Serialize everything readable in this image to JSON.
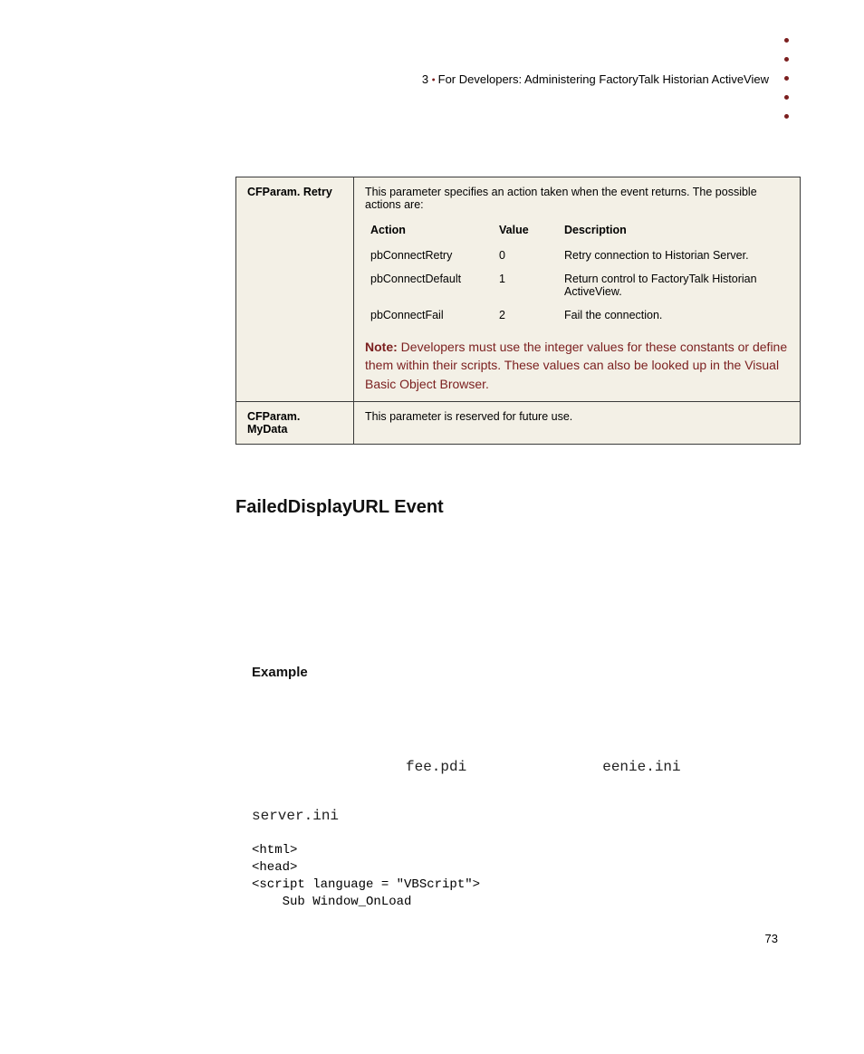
{
  "header": {
    "chapter_num": "3",
    "chapter_title": "For Developers: Administering FactoryTalk Historian ActiveView"
  },
  "table": {
    "rows": [
      {
        "param": "CFParam. Retry",
        "desc_intro": "This parameter specifies an action taken when the event returns. The possible actions are:",
        "subtable": {
          "headers": [
            "Action",
            "Value",
            "Description"
          ],
          "rows": [
            [
              "pbConnectRetry",
              "0",
              "Retry connection to Historian Server."
            ],
            [
              "pbConnectDefault",
              "1",
              "Return control to FactoryTalk Historian ActiveView."
            ],
            [
              "pbConnectFail",
              "2",
              "Fail the connection."
            ]
          ]
        },
        "note_label": "Note:",
        "note_text": " Developers must use the integer values for these constants or define them within their scripts. These values can also be looked up in the Visual Basic Object Browser."
      },
      {
        "param": "CFParam. MyData",
        "desc": "This parameter is reserved for future use."
      }
    ]
  },
  "section_heading": "FailedDisplayURL Event",
  "example_heading": "Example",
  "example_files": {
    "f1": "fee.pdi",
    "f2": "eenie.ini",
    "f3": "server.ini"
  },
  "code": "<html>\n<head>\n<script language = \"VBScript\">\n    Sub Window_OnLoad",
  "page_number": "73"
}
